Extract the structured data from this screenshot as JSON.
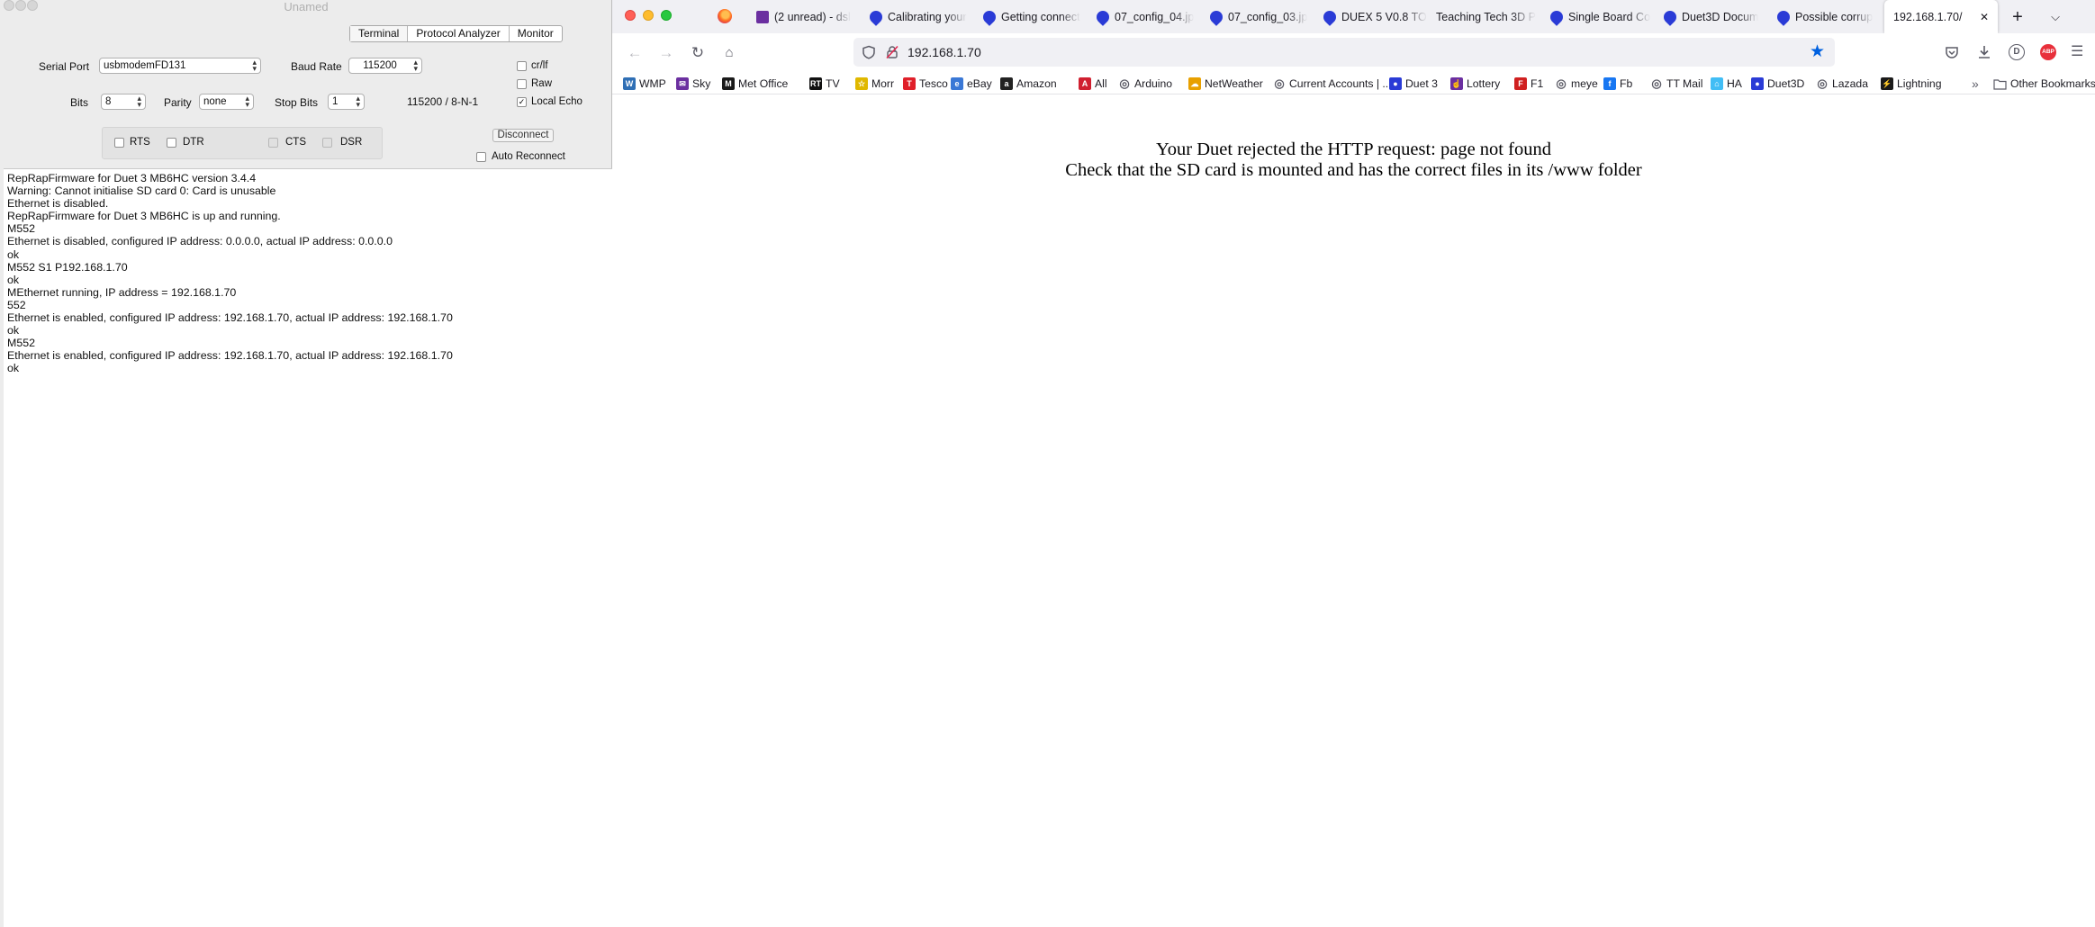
{
  "serial": {
    "window_title": "Unamed",
    "tabs": [
      {
        "label": "Terminal",
        "active": true
      },
      {
        "label": "Protocol Analyzer",
        "active": false
      },
      {
        "label": "Monitor",
        "active": false
      }
    ],
    "serial_port_label": "Serial Port",
    "serial_port_value": "usbmodemFD131",
    "baud_rate_label": "Baud Rate",
    "baud_rate_value": "115200",
    "bits_label": "Bits",
    "bits_value": "8",
    "parity_label": "Parity",
    "parity_value": "none",
    "stop_bits_label": "Stop Bits",
    "stop_bits_value": "1",
    "config_summary": "115200 / 8-N-1",
    "crlf_label": "cr/lf",
    "crlf_checked": false,
    "raw_label": "Raw",
    "raw_checked": false,
    "local_echo_label": "Local Echo",
    "local_echo_checked": true,
    "rts_label": "RTS",
    "dtr_label": "DTR",
    "cts_label": "CTS",
    "dsr_label": "DSR",
    "disconnect_label": "Disconnect",
    "auto_reconnect_label": "Auto Reconnect",
    "auto_reconnect_checked": false,
    "console_lines": [
      "RepRapFirmware for Duet 3 MB6HC version 3.4.4",
      "Warning: Cannot initialise SD card 0: Card is unusable",
      "Ethernet is disabled.",
      "RepRapFirmware for Duet 3 MB6HC is up and running.",
      "M552",
      "Ethernet is disabled, configured IP address: 0.0.0.0, actual IP address: 0.0.0.0",
      "ok",
      "M552 S1 P192.168.1.70",
      "ok",
      "MEthernet running, IP address = 192.168.1.70",
      "552",
      "Ethernet is enabled, configured IP address: 192.168.1.70, actual IP address: 192.168.1.70",
      "ok",
      "M552",
      "Ethernet is enabled, configured IP address: 192.168.1.70, actual IP address: 192.168.1.70",
      "ok"
    ]
  },
  "browser": {
    "tabs": [
      {
        "label": "(2 unread) - dsl",
        "icon": "mail-icon",
        "color": "#6b2fa0"
      },
      {
        "label": "Calibrating your",
        "icon": "duet-icon",
        "color": "#2a3bd6"
      },
      {
        "label": "Getting connect",
        "icon": "duet-icon",
        "color": "#2a3bd6"
      },
      {
        "label": "07_config_04.jp",
        "icon": "duet-icon",
        "color": "#2a3bd6"
      },
      {
        "label": "07_config_03.jp",
        "icon": "duet-icon",
        "color": "#2a3bd6"
      },
      {
        "label": "DUEX 5 V0.8 TO",
        "icon": "duet-icon",
        "color": "#2a3bd6"
      },
      {
        "label": "Teaching Tech 3D P",
        "icon": "none",
        "color": ""
      },
      {
        "label": "Single Board Co",
        "icon": "duet-icon",
        "color": "#2a3bd6"
      },
      {
        "label": "Duet3D Docum",
        "icon": "duet-icon",
        "color": "#2a3bd6"
      },
      {
        "label": "Possible corrup",
        "icon": "duet-icon",
        "color": "#2a3bd6"
      },
      {
        "label": "192.168.1.70/",
        "icon": "none",
        "color": ""
      }
    ],
    "url": "192.168.1.70",
    "bookmarks": [
      {
        "label": "WMP",
        "color": "#2f6fb5",
        "glyph": "W"
      },
      {
        "label": "Sky",
        "color": "#6b2fa0",
        "glyph": "✉"
      },
      {
        "label": "Met Office",
        "color": "#1a1a1a",
        "glyph": "M"
      },
      {
        "label": "TV",
        "color": "#111111",
        "glyph": "RT"
      },
      {
        "label": "Morr",
        "color": "#e0b800",
        "glyph": "☆"
      },
      {
        "label": "Tesco",
        "color": "#e0202a",
        "glyph": "T"
      },
      {
        "label": "eBay",
        "color": "#3a78d6",
        "glyph": "e"
      },
      {
        "label": "Amazon",
        "color": "#222222",
        "glyph": "a"
      },
      {
        "label": "All",
        "color": "#d02030",
        "glyph": "A"
      },
      {
        "label": "Arduino",
        "color": "#5b5b66",
        "glyph": "◎"
      },
      {
        "label": "NetWeather",
        "color": "#e8a000",
        "glyph": "☁"
      },
      {
        "label": "Current Accounts | ...",
        "color": "#5b5b66",
        "glyph": "◎"
      },
      {
        "label": "Duet 3",
        "color": "#2a3bd6",
        "glyph": "●"
      },
      {
        "label": "Lottery",
        "color": "#6b2fa0",
        "glyph": "☝"
      },
      {
        "label": "F1",
        "color": "#d02020",
        "glyph": "F"
      },
      {
        "label": "meye",
        "color": "#5b5b66",
        "glyph": "◎"
      },
      {
        "label": "Fb",
        "color": "#1877f2",
        "glyph": "f"
      },
      {
        "label": "TT Mail",
        "color": "#5b5b66",
        "glyph": "◎"
      },
      {
        "label": "HA",
        "color": "#41bdf5",
        "glyph": "⌂"
      },
      {
        "label": "Duet3D",
        "color": "#2a3bd6",
        "glyph": "●"
      },
      {
        "label": "Lazada",
        "color": "#5b5b66",
        "glyph": "◎"
      },
      {
        "label": "Lightning",
        "color": "#1a1a1a",
        "glyph": "⚡"
      }
    ],
    "other_bookmarks_label": "Other Bookmarks",
    "profile_initial": "D",
    "abp_label": "ABP",
    "page_message_line1": "Your Duet rejected the HTTP request: page not found",
    "page_message_line2": "Check that the SD card is mounted and has the correct files in its /www folder"
  }
}
